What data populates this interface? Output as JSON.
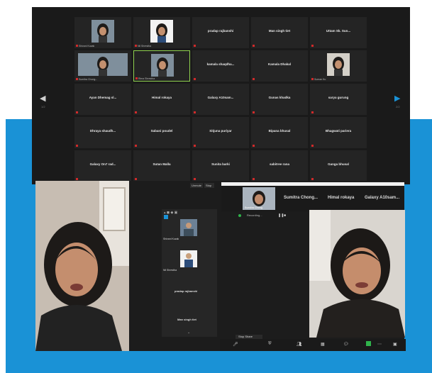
{
  "gallery": {
    "tiles": [
      {
        "name": "Shivani Kuzak",
        "video": true
      },
      {
        "name": "Nil Shrestha",
        "video": true
      },
      {
        "name": "pradap rajbanshi",
        "video": false
      },
      {
        "name": "Man singh tiet",
        "video": false
      },
      {
        "name": "Uttam Sk. Sun...",
        "video": false
      },
      {
        "name": "Sumitra Chong...",
        "video": true
      },
      {
        "name": "Rima Shrestha",
        "video": true
      },
      {
        "name": "kamala  shaqdha...",
        "video": false
      },
      {
        "name": "Kamala Dhakal",
        "video": false
      },
      {
        "name": "Suman Ku",
        "video": true
      },
      {
        "name": "Ayan Dhemag sl...",
        "video": false
      },
      {
        "name": "Himal rokaya",
        "video": false
      },
      {
        "name": "Galaxy A10sam...",
        "video": false
      },
      {
        "name": "Gunas khadka",
        "video": false
      },
      {
        "name": "sarya gurung",
        "video": false
      },
      {
        "name": "Dhraya  shaudh...",
        "video": false
      },
      {
        "name": "Sabani poudel",
        "video": false
      },
      {
        "name": "Sitjuna puriyar",
        "video": false
      },
      {
        "name": "Bipana bhusal",
        "video": false
      },
      {
        "name": "Bhagwati pariera",
        "video": false
      },
      {
        "name": "Galaxy On7 rad...",
        "video": false
      },
      {
        "name": "Sutan Malla",
        "video": false
      },
      {
        "name": "Sunita barki",
        "video": false
      },
      {
        "name": "sabitree rana",
        "video": false
      },
      {
        "name": "Ganga bhusal",
        "video": false
      }
    ]
  },
  "panel": {
    "header_tabs": [
      "Unmute",
      "Stop"
    ],
    "participants": [
      {
        "name": "Shivani Kuzak"
      },
      {
        "name": "Nil Shrestha"
      },
      {
        "name": "pradap rajbanshi"
      },
      {
        "name": "Man singh tiet"
      }
    ]
  },
  "strip": {
    "names": [
      "Sumitra Chong...",
      "Himal rokaya",
      "Galaxy A10sam..."
    ],
    "self_label": "Sumitra Chong",
    "recording": "Recording..."
  },
  "toolbar": {
    "share_label": "Stop Share",
    "buttons": [
      "mic-icon",
      "video-icon",
      "security-icon",
      "participants-icon",
      "chat-icon",
      "share-icon",
      "record-icon",
      "reactions-icon",
      "more-icon"
    ]
  },
  "colors": {
    "accent_blue": "#1a92d6",
    "active_border": "#8fd14f",
    "mic_muted": "#d02a2a",
    "share_green": "#2fb44b"
  }
}
